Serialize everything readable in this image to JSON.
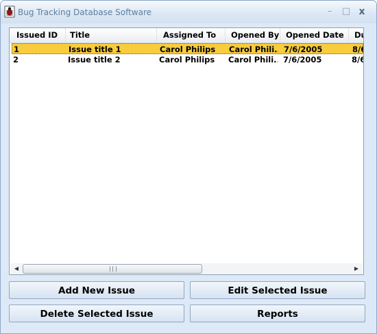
{
  "window": {
    "title": "Bug Tracking Database Software",
    "icon": "bug-icon",
    "controls": {
      "minimize": "–",
      "maximize": "□",
      "close": "x"
    }
  },
  "list": {
    "columns": [
      "Issued ID",
      "Title",
      "Assigned To",
      "Opened By",
      "Opened Date",
      "Du"
    ],
    "rows": [
      {
        "id": "1",
        "title": "Issue title 1",
        "assigned_to": "Carol Philips",
        "opened_by": "Carol Phili...",
        "opened_date": "7/6/2005",
        "due": "8/6"
      },
      {
        "id": "2",
        "title": "Issue title 2",
        "assigned_to": "Carol Philips",
        "opened_by": "Carol Phili...",
        "opened_date": "7/6/2005",
        "due": "8/6"
      }
    ],
    "selected_row": 1
  },
  "buttons": {
    "add": "Add New Issue",
    "edit": "Edit Selected Issue",
    "delete": "Delete Selected Issue",
    "reports": "Reports"
  },
  "colors": {
    "selection": "#f8cc3d",
    "window_bg": "#dde9f6",
    "border": "#8aa5c9"
  }
}
